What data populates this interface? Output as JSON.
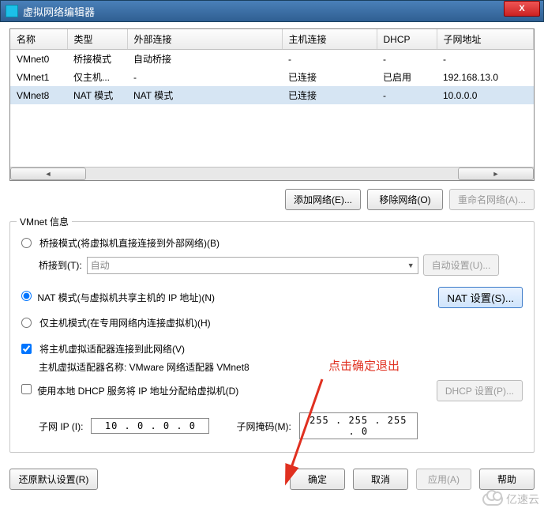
{
  "title": "虚拟网络编辑器",
  "columns": {
    "c0": "名称",
    "c1": "类型",
    "c2": "外部连接",
    "c3": "主机连接",
    "c4": "DHCP",
    "c5": "子网地址"
  },
  "rows": [
    {
      "name": "VMnet0",
      "type": "桥接模式",
      "ext": "自动桥接",
      "host": "-",
      "dhcp": "-",
      "subnet": "-"
    },
    {
      "name": "VMnet1",
      "type": "仅主机...",
      "ext": "-",
      "host": "已连接",
      "dhcp": "已启用",
      "subnet": "192.168.13.0"
    },
    {
      "name": "VMnet8",
      "type": "NAT 模式",
      "ext": "NAT 模式",
      "host": "已连接",
      "dhcp": "-",
      "subnet": "10.0.0.0"
    }
  ],
  "btns": {
    "add": "添加网络(E)...",
    "remove": "移除网络(O)",
    "rename": "重命名网络(A)..."
  },
  "group_label": "VMnet 信息",
  "radios": {
    "bridge": "桥接模式(将虚拟机直接连接到外部网络)(B)",
    "nat": "NAT 模式(与虚拟机共享主机的 IP 地址)(N)",
    "host": "仅主机模式(在专用网络内连接虚拟机)(H)"
  },
  "bridge_to_label": "桥接到(T):",
  "bridge_to_value": "自动",
  "auto_set": "自动设置(U)...",
  "nat_set": "NAT 设置(S)...",
  "chk_host": "将主机虚拟适配器连接到此网络(V)",
  "host_adapter_label": "主机虚拟适配器名称: VMware 网络适配器 VMnet8",
  "chk_dhcp": "使用本地 DHCP 服务将 IP 地址分配给虚拟机(D)",
  "dhcp_set": "DHCP 设置(P)...",
  "subnet_ip_label": "子网 IP (I):",
  "subnet_ip_value": "10 . 0 . 0 . 0",
  "mask_label": "子网掩码(M):",
  "mask_value": "255 . 255 . 255 . 0",
  "restore": "还原默认设置(R)",
  "ok": "确定",
  "cancel": "取消",
  "apply": "应用(A)",
  "help": "帮助",
  "annotation": "点击确定退出",
  "watermark": "亿速云"
}
